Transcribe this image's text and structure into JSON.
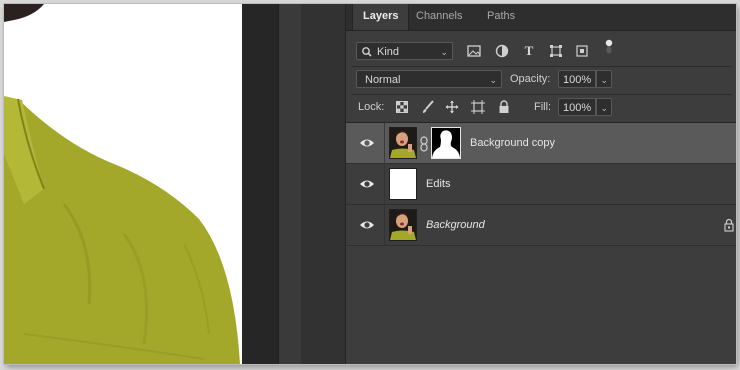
{
  "panel": {
    "tabs": [
      {
        "label": "Layers",
        "active": true
      },
      {
        "label": "Channels",
        "active": false
      },
      {
        "label": "Paths",
        "active": false
      }
    ],
    "filter": {
      "label": "Kind"
    },
    "blend_mode": {
      "value": "Normal"
    },
    "opacity": {
      "label": "Opacity:",
      "value": "100%"
    },
    "lock": {
      "label": "Lock:"
    },
    "fill": {
      "label": "Fill:",
      "value": "100%"
    }
  },
  "layers": [
    {
      "name": "Background copy",
      "selected": true,
      "visible": true,
      "has_mask": true
    },
    {
      "name": "Edits",
      "selected": false,
      "visible": true,
      "has_mask": false
    },
    {
      "name": "Background",
      "selected": false,
      "visible": true,
      "has_mask": false,
      "italic": true,
      "locked": true
    }
  ],
  "colors": {
    "panel_bg": "#3d3d3d",
    "selected_layer": "#5a5a5a",
    "shirt": "#a3a82a"
  }
}
